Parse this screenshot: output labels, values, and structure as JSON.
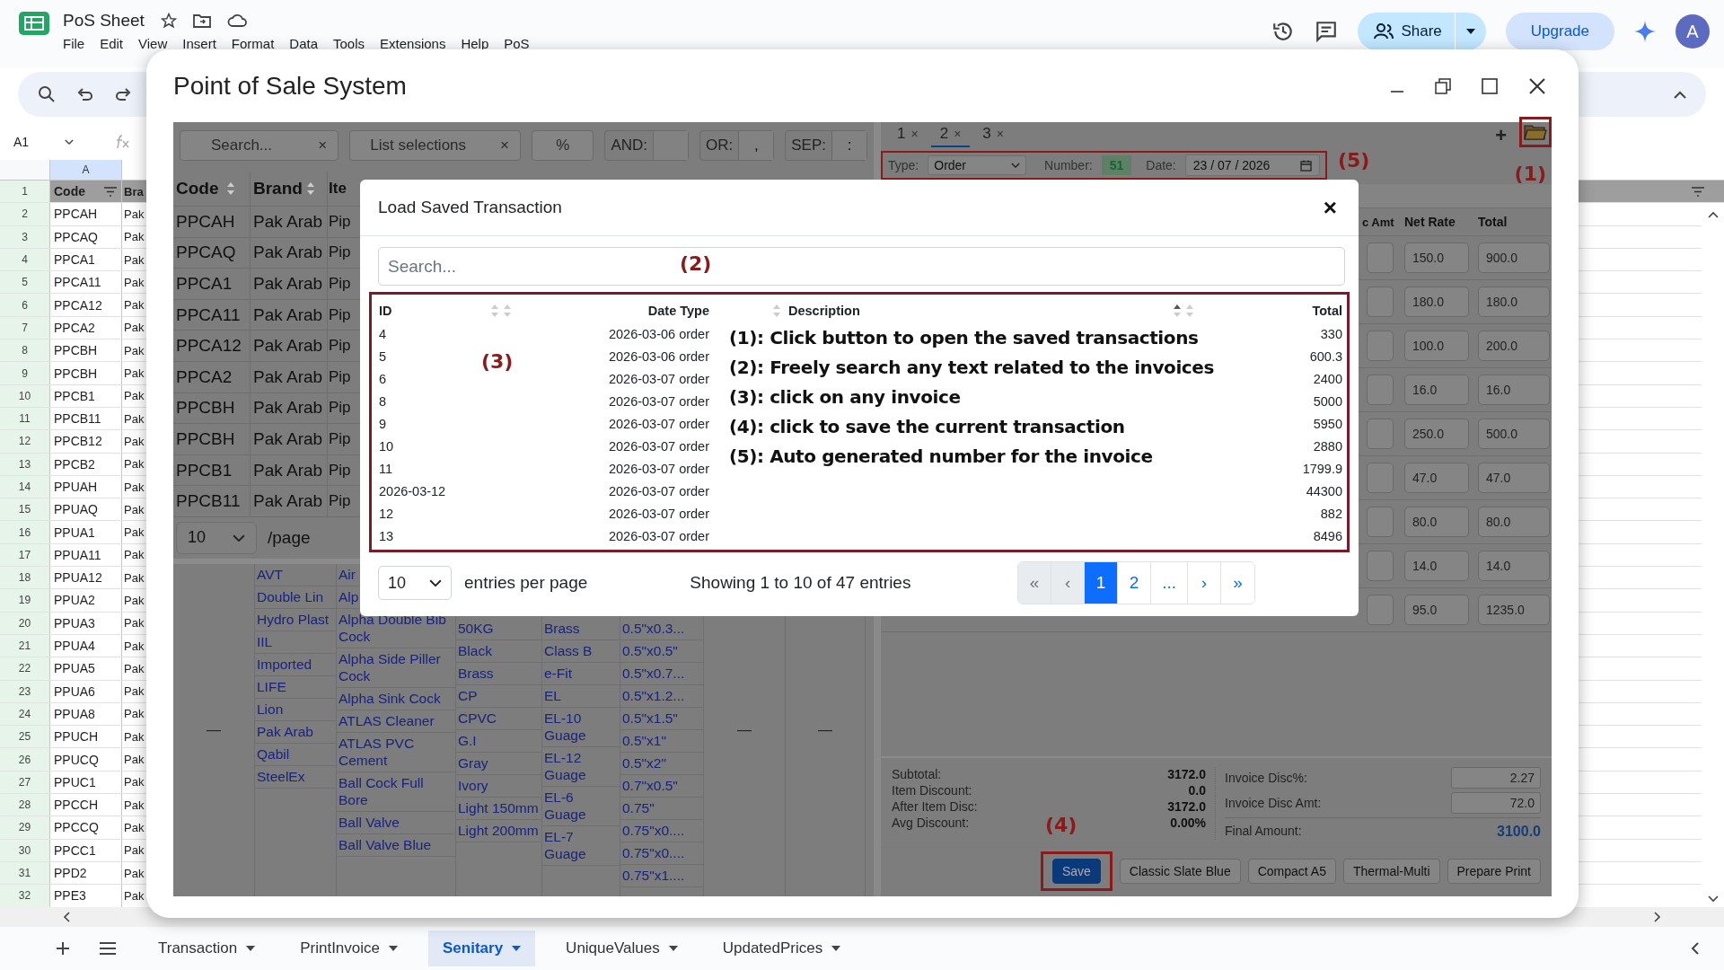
{
  "sheet": {
    "title": "PoS Sheet",
    "menu": [
      "File",
      "Edit",
      "View",
      "Insert",
      "Format",
      "Data",
      "Tools",
      "Extensions",
      "Help",
      "PoS"
    ],
    "share": "Share",
    "upgrade": "Upgrade",
    "avatar": "A",
    "name_box": "A1",
    "column_a": "A",
    "header_row": {
      "number": "1",
      "cells": [
        "Code",
        "Bra"
      ]
    },
    "rows": [
      {
        "number": "2",
        "cells": [
          "PPCAH",
          "Pak"
        ]
      },
      {
        "number": "3",
        "cells": [
          "PPCAQ",
          "Pak"
        ]
      },
      {
        "number": "4",
        "cells": [
          "PPCA1",
          "Pak"
        ]
      },
      {
        "number": "5",
        "cells": [
          "PPCA11",
          "Pak"
        ]
      },
      {
        "number": "6",
        "cells": [
          "PPCA12",
          "Pak"
        ]
      },
      {
        "number": "7",
        "cells": [
          "PPCA2",
          "Pak"
        ]
      },
      {
        "number": "8",
        "cells": [
          "PPCBH",
          "Pak"
        ]
      },
      {
        "number": "9",
        "cells": [
          "PPCBH",
          "Pak"
        ]
      },
      {
        "number": "10",
        "cells": [
          "PPCB1",
          "Pak"
        ]
      },
      {
        "number": "11",
        "cells": [
          "PPCB11",
          "Pak"
        ]
      },
      {
        "number": "12",
        "cells": [
          "PPCB12",
          "Pak"
        ]
      },
      {
        "number": "13",
        "cells": [
          "PPCB2",
          "Pak"
        ]
      },
      {
        "number": "14",
        "cells": [
          "PPUAH",
          "Pak"
        ]
      },
      {
        "number": "15",
        "cells": [
          "PPUAQ",
          "Pak"
        ]
      },
      {
        "number": "16",
        "cells": [
          "PPUA1",
          "Pak"
        ]
      },
      {
        "number": "17",
        "cells": [
          "PPUA11",
          "Pak"
        ]
      },
      {
        "number": "18",
        "cells": [
          "PPUA12",
          "Pak"
        ]
      },
      {
        "number": "19",
        "cells": [
          "PPUA2",
          "Pak"
        ]
      },
      {
        "number": "20",
        "cells": [
          "PPUA3",
          "Pak"
        ]
      },
      {
        "number": "21",
        "cells": [
          "PPUA4",
          "Pak"
        ]
      },
      {
        "number": "22",
        "cells": [
          "PPUA5",
          "Pak"
        ]
      },
      {
        "number": "23",
        "cells": [
          "PPUA6",
          "Pak"
        ]
      },
      {
        "number": "24",
        "cells": [
          "PPUA8",
          "Pak"
        ]
      },
      {
        "number": "25",
        "cells": [
          "PPUCH",
          "Pak"
        ]
      },
      {
        "number": "26",
        "cells": [
          "PPUCQ",
          "Pak"
        ]
      },
      {
        "number": "27",
        "cells": [
          "PPUC1",
          "Pak"
        ]
      },
      {
        "number": "28",
        "cells": [
          "PPCCH",
          "Pak"
        ]
      },
      {
        "number": "29",
        "cells": [
          "PPCCQ",
          "Pak"
        ]
      },
      {
        "number": "30",
        "cells": [
          "PPCC1",
          "Pak"
        ]
      },
      {
        "number": "31",
        "cells": [
          "PPD2",
          "Pak"
        ]
      },
      {
        "number": "32",
        "cells": [
          "PPE3",
          "Pak"
        ]
      }
    ]
  },
  "sheet_tabs": [
    {
      "label": "Transaction",
      "selected": false
    },
    {
      "label": "PrintInvoice",
      "selected": false
    },
    {
      "label": "Senitary",
      "selected": true
    },
    {
      "label": "UniqueValues",
      "selected": false
    },
    {
      "label": "UpdatedPrices",
      "selected": false
    }
  ],
  "pos": {
    "title": "Point of Sale System",
    "toolbar": {
      "search_placeholder": "Search...",
      "search_clear": "×",
      "list_placeholder": "List selections",
      "list_clear": "×",
      "percent": "%",
      "and_label": "AND:",
      "or_label": "OR:",
      "or_value": ",",
      "sep_label": "SEP:",
      "sep_value": ":"
    },
    "product_table": {
      "columns": [
        "Code",
        "Brand",
        "Ite"
      ],
      "rows": [
        [
          "PPCAH",
          "Pak Arab",
          "Pip"
        ],
        [
          "PPCAQ",
          "Pak Arab",
          "Pip"
        ],
        [
          "PPCA1",
          "Pak Arab",
          "Pip"
        ],
        [
          "PPCA11",
          "Pak Arab",
          "Pip"
        ],
        [
          "PPCA12",
          "Pak Arab",
          "Pip"
        ],
        [
          "PPCA2",
          "Pak Arab",
          "Pip"
        ],
        [
          "PPCBH",
          "Pak Arab",
          "Pip"
        ],
        [
          "PPCBH",
          "Pak Arab",
          "Pip"
        ],
        [
          "PPCB1",
          "Pak Arab",
          "Pip"
        ],
        [
          "PPCB11",
          "Pak Arab",
          "Pip"
        ]
      ],
      "page_size": "10",
      "page_suffix": "/page"
    },
    "filter_lists": [
      {
        "kind": "empty",
        "dash": "—"
      },
      {
        "kind": "list",
        "items": [
          "AVT",
          "Double Lin",
          "Hydro Plast",
          "IIL",
          "Imported",
          "LIFE",
          "Lion",
          "Pak Arab",
          "Qabil",
          "SteelEx"
        ]
      },
      {
        "kind": "list",
        "items": [
          "Air",
          "Alp",
          "Alpha Double Bib Cock",
          "Alpha Side Piller Cock",
          "Alpha Sink Cock",
          "ATLAS Cleaner",
          "ATLAS PVC Cement",
          "Ball Cock Full Bore",
          "Ball Valve",
          "Ball Valve Blue"
        ]
      },
      {
        "kind": "list",
        "items": [
          "50KG",
          "Black",
          "Brass",
          "CP",
          "CPVC",
          "G.I",
          "Gray",
          "Ivory",
          "Light 150mm",
          "Light 200mm"
        ]
      },
      {
        "kind": "list",
        "items": [
          "Brass",
          "Class B",
          "e-Fit",
          "EL",
          "EL-10 Guage",
          "EL-12 Guage",
          "EL-6 Guage",
          "EL-7 Guage"
        ]
      },
      {
        "kind": "list",
        "items": [
          "0.5\"x0.3...",
          "0.5\"x0.5\"",
          "0.5\"x0.7...",
          "0.5\"x1.2...",
          "0.5\"x1.5\"",
          "0.5\"x1\"",
          "0.5\"x2\"",
          "0.7\"x0.5\"",
          "0.75\"",
          "0.75\"x0....",
          "0.75\"x0....",
          "0.75\"x1...."
        ]
      },
      {
        "kind": "empty",
        "dash": "—"
      },
      {
        "kind": "empty",
        "dash": "—"
      }
    ],
    "invoice_tabs": [
      {
        "label": "1",
        "close": "×",
        "selected": false
      },
      {
        "label": "2",
        "close": "×",
        "selected": true
      },
      {
        "label": "3",
        "close": "×",
        "selected": false
      }
    ],
    "add_tab": "+",
    "meta": {
      "type_label": "Type:",
      "type": "Order",
      "number_label": "Number:",
      "number": "51",
      "date_label": "Date:",
      "date": "23 / 07 / 2026"
    },
    "line_table": {
      "columns": [
        "c Amt",
        "Net Rate",
        "Total"
      ],
      "rows": [
        [
          "",
          "150.0",
          "900.0"
        ],
        [
          "",
          "180.0",
          "180.0"
        ],
        [
          "",
          "100.0",
          "200.0"
        ],
        [
          "",
          "16.0",
          "16.0"
        ],
        [
          "",
          "250.0",
          "500.0"
        ],
        [
          "",
          "47.0",
          "47.0"
        ],
        [
          "",
          "80.0",
          "80.0"
        ],
        [
          "",
          "14.0",
          "14.0"
        ],
        [
          "",
          "95.0",
          "1235.0"
        ]
      ]
    },
    "summary": [
      {
        "label": "Subtotal:",
        "value": "3172.0"
      },
      {
        "label": "Item Discount:",
        "value": "0.0"
      },
      {
        "label": "After Item Disc:",
        "value": "3172.0"
      },
      {
        "label": "Avg Discount:",
        "value": "0.00%"
      }
    ],
    "invoice_discount": [
      {
        "label": "Invoice Disc%:",
        "value": "2.27"
      },
      {
        "label": "Invoice Disc Amt:",
        "value": "72.0"
      }
    ],
    "final": {
      "label": "Final Amount:",
      "value": "3100.0"
    },
    "actions": [
      {
        "label": "Save",
        "kind": "primary"
      },
      {
        "label": "Classic Slate Blue",
        "kind": "secondary"
      },
      {
        "label": "Compact A5",
        "kind": "secondary"
      },
      {
        "label": "Thermal-Multi",
        "kind": "secondary"
      },
      {
        "label": "Prepare Print",
        "kind": "secondary"
      }
    ]
  },
  "modal": {
    "title": "Load Saved Transaction",
    "close": "×",
    "search_placeholder": "Search...",
    "columns": [
      "ID",
      "Date Type",
      "Description",
      "Total"
    ],
    "rows": [
      {
        "id": "4",
        "date_type": "2026-03-06 order",
        "total": "330"
      },
      {
        "id": "5",
        "date_type": "2026-03-06 order",
        "total": "600.3"
      },
      {
        "id": "6",
        "date_type": "2026-03-07 order",
        "total": "2400"
      },
      {
        "id": "8",
        "date_type": "2026-03-07 order",
        "total": "5000"
      },
      {
        "id": "9",
        "date_type": "2026-03-07 order",
        "total": "5950"
      },
      {
        "id": "10",
        "date_type": "2026-03-07 order",
        "total": "2880"
      },
      {
        "id": "11",
        "date_type": "2026-03-07 order",
        "total": "1799.9"
      },
      {
        "id": "2026-03-12",
        "date_type": "2026-03-07 order",
        "total": "44300"
      },
      {
        "id": "12",
        "date_type": "2026-03-07 order",
        "total": "882"
      },
      {
        "id": "13",
        "date_type": "2026-03-07 order",
        "total": "8496"
      }
    ],
    "page_size": "10",
    "per_page": "entries per page",
    "info": "Showing 1 to 10 of 47 entries",
    "pages": [
      {
        "label": "«",
        "kind": "nav",
        "selected": false
      },
      {
        "label": "‹",
        "kind": "nav",
        "selected": false
      },
      {
        "label": "1",
        "kind": "page",
        "selected": true
      },
      {
        "label": "2",
        "kind": "page",
        "selected": false
      },
      {
        "label": "...",
        "kind": "page",
        "selected": false
      },
      {
        "label": "›",
        "kind": "page",
        "selected": false
      },
      {
        "label": "»",
        "kind": "page",
        "selected": false
      }
    ]
  },
  "annotations": {
    "folder": "(1)",
    "search": "(2)",
    "table": "(3)",
    "save": "(4)",
    "meta": "(5)",
    "notes": [
      "(1): Click button to open the saved transactions",
      "(2): Freely search any text related to the invoices",
      "(3): click on any invoice",
      "(4): click to save the current transaction",
      "(5): Auto generated number for the invoice"
    ]
  }
}
